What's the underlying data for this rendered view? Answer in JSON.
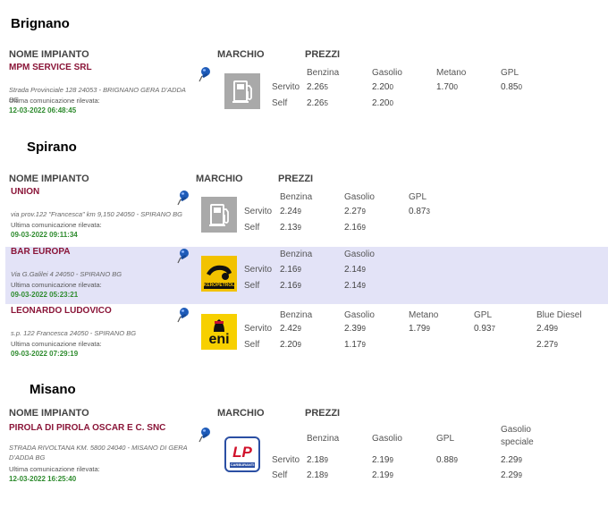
{
  "headers": {
    "nome": "NOME IMPIANTO",
    "marchio": "MARCHIO",
    "prezzi": "PREZZI",
    "servito": "Servito",
    "self": "Self",
    "comm_label": "Ultima comunicazione rilevata:"
  },
  "sections": [
    {
      "town": "Brignano",
      "stations": [
        {
          "name": "MPM SERVICE SRL",
          "address": "Strada Provinciale 128 24053 - BRIGNANO GERA D'ADDA BG",
          "timestamp": "12-03-2022 06:48:45",
          "brand": "generic-pump",
          "fuels": [
            {
              "label": "Benzina",
              "servito": "2.265",
              "self": "2.265"
            },
            {
              "label": "Gasolio",
              "servito": "2.200",
              "self": "2.200"
            },
            {
              "label": "Metano",
              "servito": "1.700",
              "self": ""
            },
            {
              "label": "GPL",
              "servito": "0.850",
              "self": ""
            }
          ]
        }
      ]
    },
    {
      "town": "Spirano",
      "stations": [
        {
          "name": "UNION",
          "address": "via prov.122 \"Francesca\" km 9,150 24050 - SPIRANO BG",
          "timestamp": "09-03-2022 09:11:34",
          "brand": "generic-pump",
          "fuels": [
            {
              "label": "Benzina",
              "servito": "2.249",
              "self": "2.139"
            },
            {
              "label": "Gasolio",
              "servito": "2.279",
              "self": "2.169"
            },
            {
              "label": "GPL",
              "servito": "0.873",
              "self": ""
            }
          ]
        },
        {
          "name": "BAR EUROPA",
          "address": "Via G.Galilei 4 24050 - SPIRANO BG",
          "timestamp": "09-03-2022 05:23:21",
          "brand": "keropetrol",
          "brand_text": "KEROPETROL",
          "fuels": [
            {
              "label": "Benzina",
              "servito": "2.169",
              "self": "2.169"
            },
            {
              "label": "Gasolio",
              "servito": "2.149",
              "self": "2.149"
            }
          ]
        },
        {
          "name": "LEONARDO LUDOVICO",
          "address": "s.p. 122 Francesca 24050 - SPIRANO BG",
          "timestamp": "09-03-2022 07:29:19",
          "brand": "eni",
          "brand_text": "eni",
          "fuels": [
            {
              "label": "Benzina",
              "servito": "2.429",
              "self": "2.209"
            },
            {
              "label": "Gasolio",
              "servito": "2.399",
              "self": "1.179"
            },
            {
              "label": "Metano",
              "servito": "1.799",
              "self": ""
            },
            {
              "label": "GPL",
              "servito": "0.937",
              "self": ""
            },
            {
              "label": "Blue Diesel",
              "servito": "2.499",
              "self": "2.279"
            }
          ]
        }
      ]
    },
    {
      "town": "Misano",
      "stations": [
        {
          "name": "PIROLA DI PIROLA OSCAR E C. SNC",
          "address": "STRADA RIVOLTANA KM. 5800 24040 - MISANO DI GERA D'ADDA BG",
          "timestamp": "12-03-2022 16:25:40",
          "brand": "lp",
          "brand_text": "LP",
          "brand_sub": "CARBURANTI",
          "fuels": [
            {
              "label": "Benzina",
              "servito": "2.189",
              "self": "2.189"
            },
            {
              "label": "Gasolio",
              "servito": "2.199",
              "self": "2.199"
            },
            {
              "label": "GPL",
              "servito": "0.889",
              "self": ""
            },
            {
              "label": "Gasolio speciale",
              "servito": "2.299",
              "self": "2.299"
            }
          ]
        }
      ]
    }
  ],
  "colors": {
    "station_name": "#8a1538",
    "timestamp": "#2e8b2e",
    "highlight_row": "#e3e3f7",
    "pin": "#1e5bb8"
  }
}
